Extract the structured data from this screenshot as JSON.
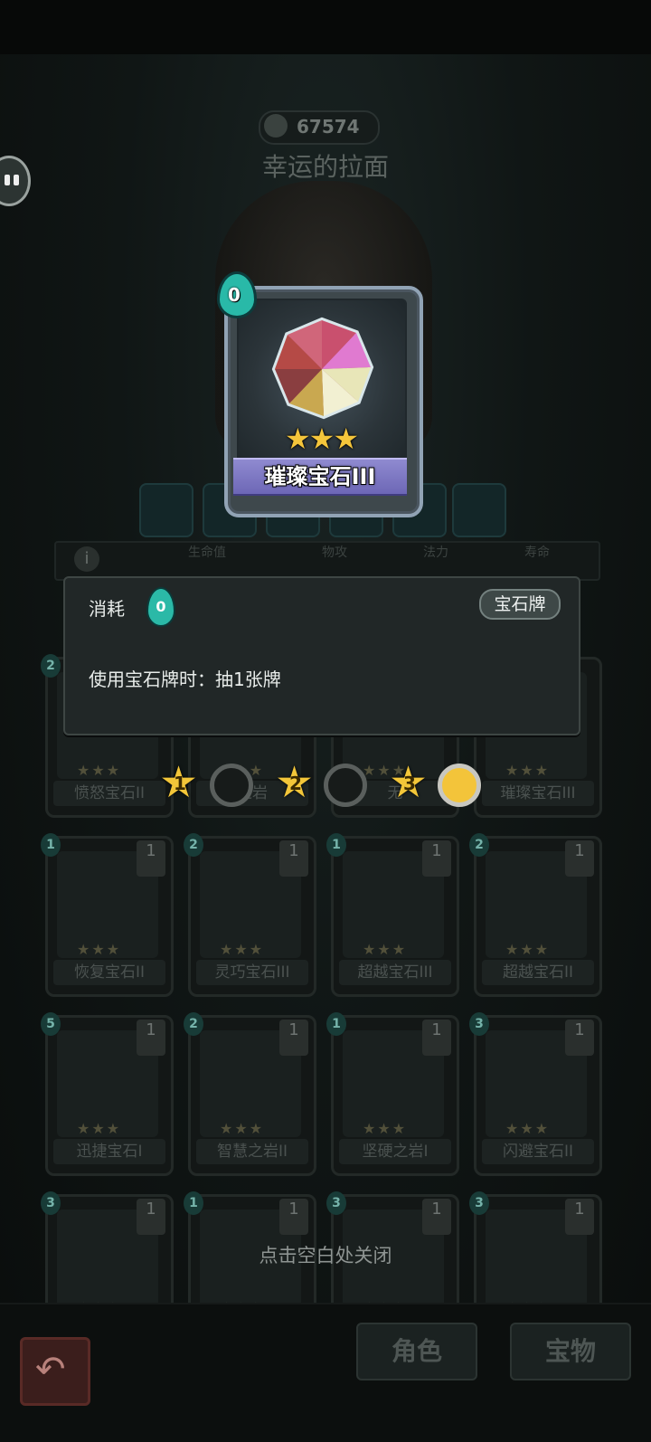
{
  "header": {
    "currency_value": "67574",
    "currency_icon": "wrench-icon",
    "character_name": "幸运的拉面"
  },
  "stats": {
    "labels": [
      "生命值",
      "物攻",
      "法力",
      "寿命"
    ]
  },
  "deck": {
    "rows": [
      [
        {
          "cost": "2",
          "name": "愤怒宝石II",
          "count": ""
        },
        {
          "cost": "",
          "name": "之岩",
          "count": ""
        },
        {
          "cost": "",
          "name": "无",
          "count": ""
        },
        {
          "cost": "",
          "name": "璀璨宝石III",
          "count": ""
        }
      ],
      [
        {
          "cost": "1",
          "name": "恢复宝石II",
          "count": "1"
        },
        {
          "cost": "2",
          "name": "灵巧宝石III",
          "count": "1"
        },
        {
          "cost": "1",
          "name": "超越宝石III",
          "count": "1"
        },
        {
          "cost": "2",
          "name": "超越宝石II",
          "count": "1"
        }
      ],
      [
        {
          "cost": "5",
          "name": "迅捷宝石I",
          "count": "1"
        },
        {
          "cost": "2",
          "name": "智慧之岩II",
          "count": "1"
        },
        {
          "cost": "1",
          "name": "坚硬之岩I",
          "count": "1"
        },
        {
          "cost": "3",
          "name": "闪避宝石II",
          "count": "1"
        }
      ],
      [
        {
          "cost": "3",
          "name": "",
          "count": "1"
        },
        {
          "cost": "1",
          "name": "",
          "count": "1"
        },
        {
          "cost": "3",
          "name": "",
          "count": "1"
        },
        {
          "cost": "3",
          "name": "",
          "count": "1"
        }
      ]
    ]
  },
  "selected_card": {
    "name": "璀璨宝石III",
    "cost": "0",
    "stars": "★★★"
  },
  "tooltip": {
    "cost_label": "消耗",
    "cost_value": "0",
    "type_tag": "宝石牌",
    "description": "使用宝石牌时：抽1张牌"
  },
  "upgrade_levels": [
    {
      "level": "1",
      "unlocked": false
    },
    {
      "level": "2",
      "unlocked": false
    },
    {
      "level": "3",
      "unlocked": true
    }
  ],
  "close_hint": "点击空白处关闭",
  "bottom_nav": {
    "tab_character": "角色",
    "tab_treasure": "宝物"
  },
  "colors": {
    "accent_gold": "#f3c43a",
    "mana_teal": "#29b9a8",
    "banner_purple": "#7f79c4"
  }
}
